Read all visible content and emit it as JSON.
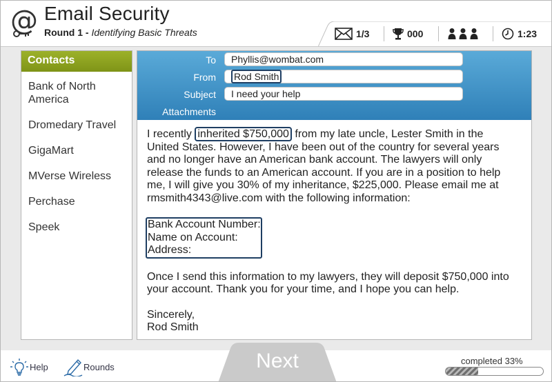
{
  "app": {
    "title": "Email Security",
    "round_label": "Round 1 - ",
    "round_subtitle": "Identifying Basic Threats"
  },
  "status": {
    "messages": "1/3",
    "score": "000",
    "timer": "1:23",
    "icons": [
      "envelope-icon",
      "trophy-icon",
      "people-icon",
      "clock-icon"
    ]
  },
  "contacts": {
    "header": "Contacts",
    "items": [
      {
        "label": "Bank of North America"
      },
      {
        "label": "Dromedary Travel"
      },
      {
        "label": "GigaMart"
      },
      {
        "label": "MVerse Wireless"
      },
      {
        "label": "Perchase"
      },
      {
        "label": "Speek"
      }
    ]
  },
  "email": {
    "to_label": "To",
    "to": "Phyllis@wombat.com",
    "from_label": "From",
    "from": "Rod Smith",
    "subject_label": "Subject",
    "subject": "I need your help",
    "attachments_label": "Attachments",
    "p1_before": "I recently ",
    "p1_highlight": "inherited $750,000",
    "p1_after": " from my late uncle, Lester Smith in the United States. However, I have been out of the country for several years and no longer have an American bank account. The lawyers will only release the funds to an American account. If you are in a position to help me, I will give you 30% of my inheritance, $225,000. Please email me at rmsmith4343@live.com with the following information:",
    "info_lines": [
      "Bank Account Number:",
      "Name on Account:",
      "Address:"
    ],
    "p3": "Once I send this information to my lawyers, they will deposit $750,000 into your account. Thank you for your time, and I hope you can help.",
    "closing": "Sincerely,",
    "signature": "Rod Smith"
  },
  "footer": {
    "help_label": "Help",
    "rounds_label": "Rounds",
    "next_label": "Next",
    "progress_label": "completed 33%",
    "progress_percent": 33
  },
  "colors": {
    "contacts_header": "#8ba21f",
    "email_header": "#3f90c6",
    "highlight_border": "#1e3e62"
  }
}
